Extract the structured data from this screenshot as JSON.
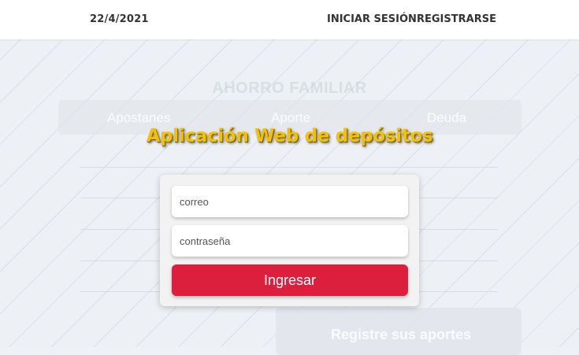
{
  "header": {
    "date": "22/4/2021",
    "login_link": "INICIAR SESIÓN",
    "register_link": "REGISTRARSE"
  },
  "background": {
    "title": "AHORRO FAMILIAR",
    "tabs": [
      "Apostanes",
      "Aporte",
      "Deuda"
    ],
    "panel_label": "Registre sus aportes"
  },
  "app_title": "Aplicación Web de depósitos",
  "login": {
    "email_placeholder": "correo",
    "password_placeholder": "contraseña",
    "submit_label": "Ingresar"
  },
  "colors": {
    "accent_red": "#dc1f3c",
    "title_yellow": "#f4c000"
  }
}
